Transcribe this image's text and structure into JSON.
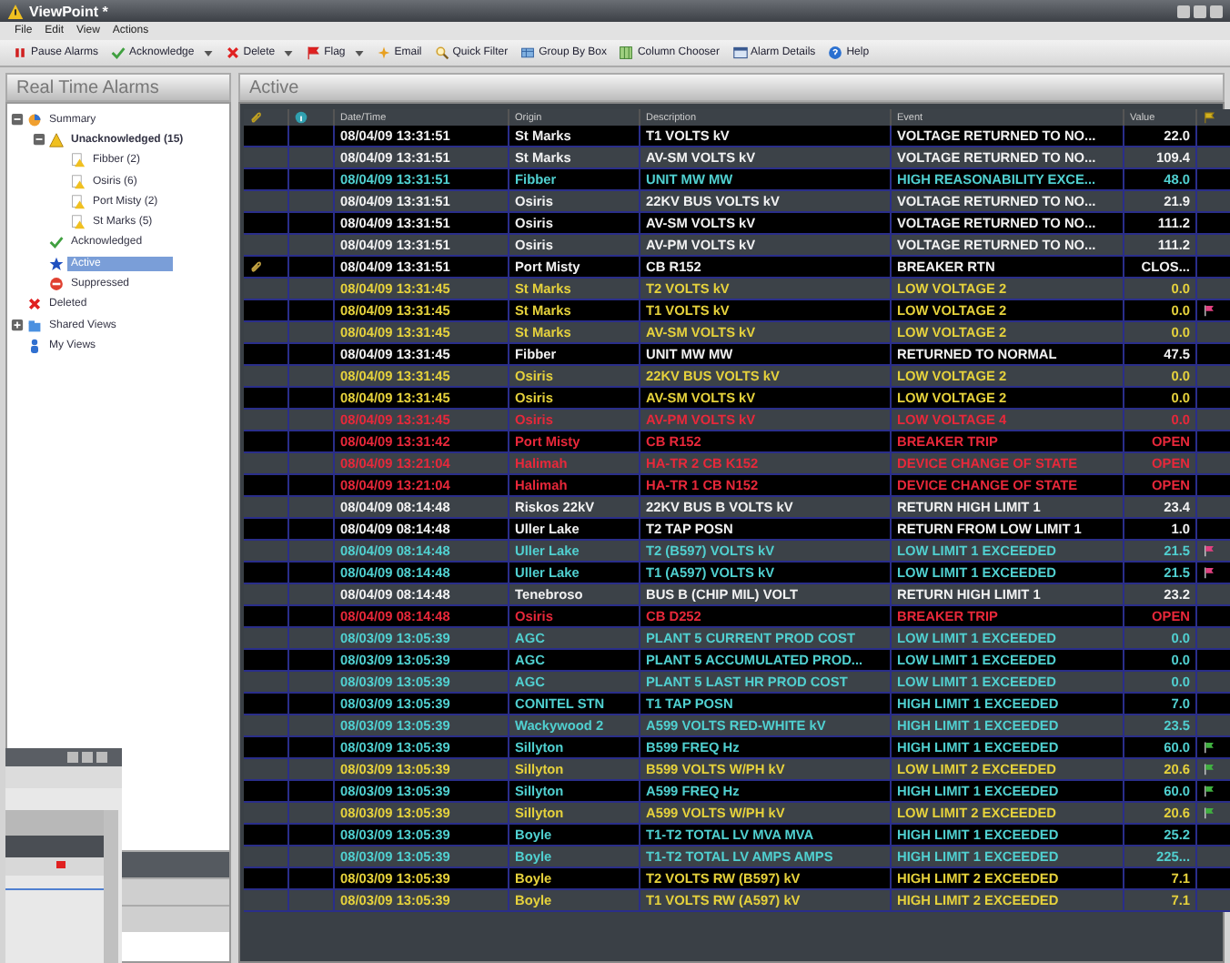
{
  "window": {
    "title": "ViewPoint *"
  },
  "menu": [
    "File",
    "Edit",
    "View",
    "Actions"
  ],
  "toolbar": [
    {
      "label": "Pause Alarms",
      "dropdown": false
    },
    {
      "label": "Acknowledge",
      "dropdown": true
    },
    {
      "label": "Delete",
      "dropdown": true
    },
    {
      "label": "Flag",
      "dropdown": true
    },
    {
      "label": "Email",
      "dropdown": false
    },
    {
      "label": "Quick Filter",
      "dropdown": false
    },
    {
      "label": "Group By Box",
      "dropdown": false
    },
    {
      "label": "Column Chooser",
      "dropdown": false
    },
    {
      "label": "Alarm Details",
      "dropdown": false
    },
    {
      "label": "Help",
      "dropdown": false
    }
  ],
  "sidebar": {
    "title": "Real Time Alarms",
    "items": [
      {
        "label": "Summary",
        "selected": false,
        "expanded": true,
        "children": [
          {
            "label": "Unacknowledged (15)",
            "selected": false,
            "expanded": true,
            "children": [
              {
                "label": "Fibber (2)",
                "selected": false
              },
              {
                "label": "Osiris (6)",
                "selected": false
              },
              {
                "label": "Port Misty (2)",
                "selected": false
              },
              {
                "label": "St Marks (5)",
                "selected": false
              }
            ]
          },
          {
            "label": "Acknowledged",
            "selected": false
          },
          {
            "label": "Active",
            "selected": true
          },
          {
            "label": "Suppressed",
            "selected": false
          }
        ]
      },
      {
        "label": "Deleted",
        "selected": false
      },
      {
        "label": "Shared Views",
        "selected": false,
        "expanded": false
      },
      {
        "label": "My Views",
        "selected": false
      }
    ]
  },
  "table": {
    "title": "Active",
    "columns": [
      {
        "kind": "attachment"
      },
      {
        "kind": "info"
      },
      {
        "kind": "text",
        "label": "Date/Time"
      },
      {
        "kind": "text",
        "label": "Origin"
      },
      {
        "kind": "text",
        "label": "Description"
      },
      {
        "kind": "text",
        "label": "Event"
      },
      {
        "kind": "value",
        "label": "Value"
      },
      {
        "kind": "flag"
      }
    ],
    "rows": [
      {
        "kind": "normal",
        "cells": [
          "",
          "",
          "08/04/09 13:31:51",
          "St Marks",
          "T1 VOLTS  kV",
          "VOLTAGE RETURNED TO NO...",
          "22.0",
          ""
        ]
      },
      {
        "kind": "normal",
        "cells": [
          "",
          "",
          "08/04/09 13:31:51",
          "St Marks",
          "AV-SM VOLTS  kV",
          "VOLTAGE RETURNED TO NO...",
          "109.4",
          ""
        ]
      },
      {
        "kind": "info",
        "cells": [
          "",
          "",
          "08/04/09 13:31:51",
          "Fibber",
          "UNIT MW  MW",
          "HIGH REASONABILITY EXCE...",
          "48.0",
          ""
        ]
      },
      {
        "kind": "normal",
        "cells": [
          "",
          "",
          "08/04/09 13:31:51",
          "Osiris",
          "22KV BUS VOLTS  kV",
          "VOLTAGE RETURNED TO NO...",
          "21.9",
          ""
        ]
      },
      {
        "kind": "normal",
        "cells": [
          "",
          "",
          "08/04/09 13:31:51",
          "Osiris",
          "AV-SM VOLTS  kV",
          "VOLTAGE RETURNED TO NO...",
          "111.2",
          ""
        ]
      },
      {
        "kind": "normal",
        "cells": [
          "",
          "",
          "08/04/09 13:31:51",
          "Osiris",
          "AV-PM VOLTS  kV",
          "VOLTAGE RETURNED TO NO...",
          "111.2",
          ""
        ]
      },
      {
        "kind": "normal",
        "attachment": true,
        "cells": [
          "",
          "",
          "08/04/09 13:31:51",
          "Port Misty",
          "CB R152",
          "BREAKER RTN",
          "CLOS...",
          ""
        ]
      },
      {
        "kind": "warning",
        "cells": [
          "",
          "",
          "08/04/09 13:31:45",
          "St Marks",
          "T2 VOLTS  kV",
          "LOW VOLTAGE 2",
          "0.0",
          ""
        ]
      },
      {
        "kind": "warning",
        "color": "#e04080",
        "cells": [
          "",
          "",
          "08/04/09 13:31:45",
          "St Marks",
          "T1 VOLTS  kV",
          "LOW VOLTAGE 2",
          "0.0",
          ""
        ]
      },
      {
        "kind": "warning",
        "cells": [
          "",
          "",
          "08/04/09 13:31:45",
          "St Marks",
          "AV-SM VOLTS  kV",
          "LOW VOLTAGE 2",
          "0.0",
          ""
        ]
      },
      {
        "kind": "normal",
        "cells": [
          "",
          "",
          "08/04/09 13:31:45",
          "Fibber",
          "UNIT MW  MW",
          "RETURNED TO NORMAL",
          "47.5",
          ""
        ]
      },
      {
        "kind": "warning",
        "cells": [
          "",
          "",
          "08/04/09 13:31:45",
          "Osiris",
          "22KV BUS VOLTS  kV",
          "LOW VOLTAGE 2",
          "0.0",
          ""
        ]
      },
      {
        "kind": "warning",
        "cells": [
          "",
          "",
          "08/04/09 13:31:45",
          "Osiris",
          "AV-SM VOLTS  kV",
          "LOW VOLTAGE 2",
          "0.0",
          ""
        ]
      },
      {
        "kind": "critical",
        "cells": [
          "",
          "",
          "08/04/09 13:31:45",
          "Osiris",
          "AV-PM VOLTS  kV",
          "LOW VOLTAGE 4",
          "0.0",
          ""
        ]
      },
      {
        "kind": "critical",
        "cells": [
          "",
          "",
          "08/04/09 13:31:42",
          "Port Misty",
          "CB R152",
          "BREAKER TRIP",
          "OPEN",
          ""
        ]
      },
      {
        "kind": "critical",
        "cells": [
          "",
          "",
          "08/04/09 13:21:04",
          "Halimah",
          "HA-TR 2 CB K152",
          "DEVICE CHANGE OF STATE",
          "OPEN",
          ""
        ]
      },
      {
        "kind": "critical",
        "cells": [
          "",
          "",
          "08/04/09 13:21:04",
          "Halimah",
          "HA-TR 1 CB N152",
          "DEVICE CHANGE OF STATE",
          "OPEN",
          ""
        ]
      },
      {
        "kind": "normal",
        "cells": [
          "",
          "",
          "08/04/09 08:14:48",
          "Riskos 22kV",
          "22KV BUS B VOLTS  kV",
          "RETURN HIGH LIMIT 1",
          "23.4",
          ""
        ]
      },
      {
        "kind": "normal",
        "cells": [
          "",
          "",
          "08/04/09 08:14:48",
          "Uller Lake",
          "T2 TAP POSN",
          "RETURN FROM LOW LIMIT 1",
          "1.0",
          ""
        ]
      },
      {
        "kind": "info",
        "color": "#e04080",
        "cells": [
          "",
          "",
          "08/04/09 08:14:48",
          "Uller Lake",
          "T2 (B597) VOLTS  kV",
          "LOW LIMIT 1 EXCEEDED",
          "21.5",
          ""
        ]
      },
      {
        "kind": "info",
        "color": "#e04080",
        "cells": [
          "",
          "",
          "08/04/09 08:14:48",
          "Uller Lake",
          "T1 (A597) VOLTS  kV",
          "LOW LIMIT 1 EXCEEDED",
          "21.5",
          ""
        ]
      },
      {
        "kind": "normal",
        "cells": [
          "",
          "",
          "08/04/09 08:14:48",
          "Tenebroso",
          "BUS B (CHIP MIL) VOLT",
          "RETURN HIGH LIMIT 1",
          "23.2",
          ""
        ]
      },
      {
        "kind": "critical",
        "cells": [
          "",
          "",
          "08/04/09 08:14:48",
          "Osiris",
          "CB D252",
          "BREAKER TRIP",
          "OPEN",
          ""
        ]
      },
      {
        "kind": "info",
        "cells": [
          "",
          "",
          "08/03/09 13:05:39",
          "AGC",
          "PLANT 5 CURRENT PROD COST",
          "LOW LIMIT 1 EXCEEDED",
          "0.0",
          ""
        ]
      },
      {
        "kind": "info",
        "cells": [
          "",
          "",
          "08/03/09 13:05:39",
          "AGC",
          "PLANT 5 ACCUMULATED PROD...",
          "LOW LIMIT 1 EXCEEDED",
          "0.0",
          ""
        ]
      },
      {
        "kind": "info",
        "cells": [
          "",
          "",
          "08/03/09 13:05:39",
          "AGC",
          "PLANT 5 LAST HR PROD COST",
          "LOW LIMIT 1 EXCEEDED",
          "0.0",
          ""
        ]
      },
      {
        "kind": "info",
        "cells": [
          "",
          "",
          "08/03/09 13:05:39",
          "CONITEL STN",
          "T1 TAP POSN",
          "HIGH LIMIT 1 EXCEEDED",
          "7.0",
          ""
        ]
      },
      {
        "kind": "info",
        "cells": [
          "",
          "",
          "08/03/09 13:05:39",
          "Wackywood 2",
          "A599 VOLTS RED-WHITE  kV",
          "HIGH LIMIT 1 EXCEEDED",
          "23.5",
          ""
        ]
      },
      {
        "kind": "info",
        "color": "#40b040",
        "cells": [
          "",
          "",
          "08/03/09 13:05:39",
          "Sillyton",
          "B599 FREQ  Hz",
          "HIGH LIMIT 1 EXCEEDED",
          "60.0",
          ""
        ]
      },
      {
        "kind": "warning",
        "color": "#40b040",
        "cells": [
          "",
          "",
          "08/03/09 13:05:39",
          "Sillyton",
          "B599 VOLTS W/PH  kV",
          "LOW LIMIT 2 EXCEEDED",
          "20.6",
          ""
        ]
      },
      {
        "kind": "info",
        "color": "#40b040",
        "cells": [
          "",
          "",
          "08/03/09 13:05:39",
          "Sillyton",
          "A599 FREQ  Hz",
          "HIGH LIMIT 1 EXCEEDED",
          "60.0",
          ""
        ]
      },
      {
        "kind": "warning",
        "color": "#40b040",
        "cells": [
          "",
          "",
          "08/03/09 13:05:39",
          "Sillyton",
          "A599 VOLTS W/PH  kV",
          "LOW LIMIT 2 EXCEEDED",
          "20.6",
          ""
        ]
      },
      {
        "kind": "info",
        "cells": [
          "",
          "",
          "08/03/09 13:05:39",
          "Boyle",
          "T1-T2 TOTAL LV MVA  MVA",
          "HIGH LIMIT 1 EXCEEDED",
          "25.2",
          ""
        ]
      },
      {
        "kind": "info",
        "cells": [
          "",
          "",
          "08/03/09 13:05:39",
          "Boyle",
          "T1-T2 TOTAL LV AMPS  AMPS",
          "HIGH LIMIT 1 EXCEEDED",
          "225...",
          ""
        ]
      },
      {
        "kind": "warning",
        "cells": [
          "",
          "",
          "08/03/09 13:05:39",
          "Boyle",
          "T2 VOLTS RW (B597)  kV",
          "HIGH LIMIT 2 EXCEEDED",
          "7.1",
          ""
        ]
      },
      {
        "kind": "warning",
        "cells": [
          "",
          "",
          "08/03/09 13:05:39",
          "Boyle",
          "T1 VOLTS RW (A597)  kV",
          "HIGH LIMIT 2 EXCEEDED",
          "7.1",
          ""
        ]
      }
    ]
  }
}
